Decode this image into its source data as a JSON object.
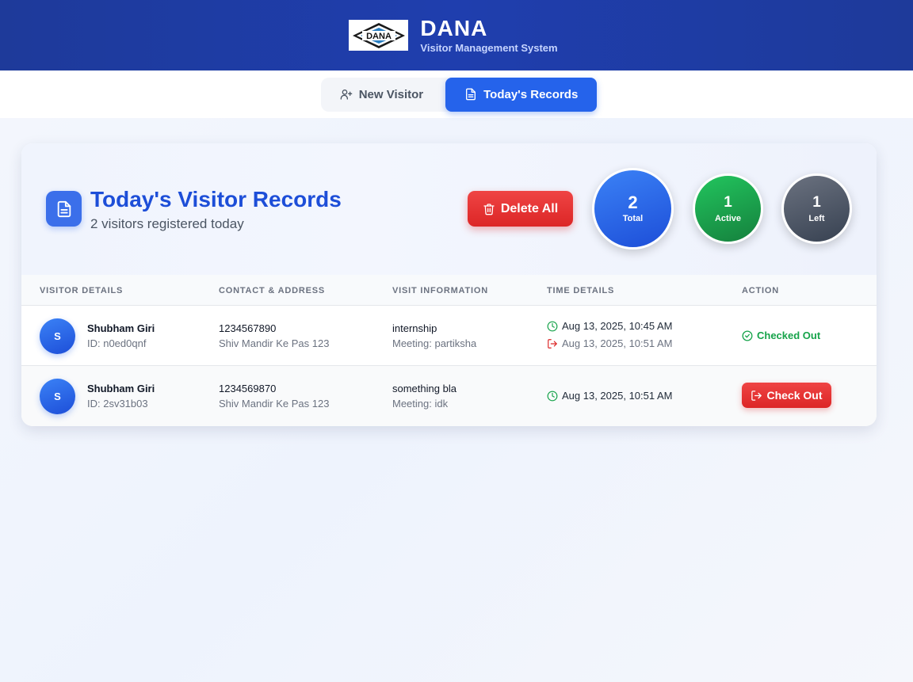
{
  "header": {
    "logo_text": "DANA",
    "title": "DANA",
    "subtitle": "Visitor Management System"
  },
  "tabs": [
    {
      "label": "New Visitor",
      "icon": "user-plus-icon",
      "active": false
    },
    {
      "label": "Today's Records",
      "icon": "document-icon",
      "active": true
    }
  ],
  "records": {
    "title": "Today's Visitor Records",
    "subtitle": "2 visitors registered today",
    "delete_all_label": "Delete All",
    "stats": {
      "total": {
        "value": "2",
        "label": "Total"
      },
      "active": {
        "value": "1",
        "label": "Active"
      },
      "left": {
        "value": "1",
        "label": "Left"
      }
    }
  },
  "table": {
    "columns": [
      "VISITOR DETAILS",
      "CONTACT & ADDRESS",
      "VISIT INFORMATION",
      "TIME DETAILS",
      "ACTION"
    ],
    "rows": [
      {
        "initial": "S",
        "name": "Shubham Giri",
        "id": "ID: n0ed0qnf",
        "phone": "1234567890",
        "address": "Shiv Mandir Ke Pas 123",
        "purpose": "internship",
        "meeting": "Meeting: partiksha",
        "time_in": "Aug 13, 2025, 10:45 AM",
        "time_out": "Aug 13, 2025, 10:51 AM",
        "action": "Checked Out"
      },
      {
        "initial": "S",
        "name": "Shubham Giri",
        "id": "ID: 2sv31b03",
        "phone": "1234569870",
        "address": "Shiv Mandir Ke Pas 123",
        "purpose": "something bla",
        "meeting": "Meeting: idk",
        "time_in": "Aug 13, 2025, 10:51 AM",
        "action": "Check Out"
      }
    ]
  },
  "colors": {
    "header_bg": "#1e3a9a",
    "accent": "#2563eb",
    "danger": "#dc2626",
    "success": "#16a34a",
    "neutral": "#4b5563"
  }
}
